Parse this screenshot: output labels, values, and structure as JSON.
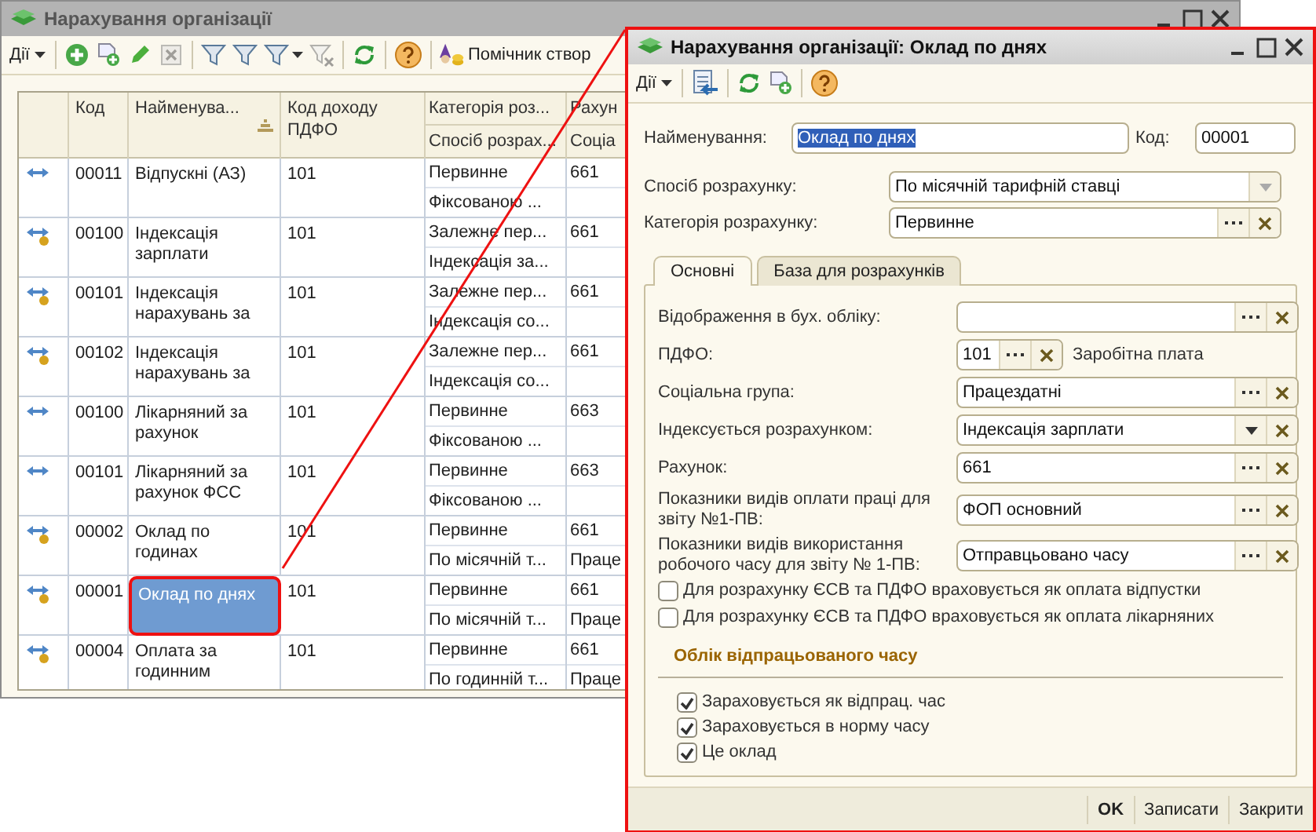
{
  "main_window": {
    "title": "Нарахування організації",
    "toolbar": {
      "actions_menu": "Дії",
      "buttons": [
        {
          "kind": "add",
          "disabled": false
        },
        {
          "kind": "copy",
          "disabled": false
        },
        {
          "kind": "edit",
          "disabled": false
        },
        {
          "kind": "delete",
          "disabled": true
        },
        {
          "kind": "separator"
        },
        {
          "kind": "filter",
          "disabled": false
        },
        {
          "kind": "filter",
          "disabled": false
        },
        {
          "kind": "filter-menu",
          "disabled": false
        },
        {
          "kind": "filter-clear",
          "disabled": true
        },
        {
          "kind": "separator"
        },
        {
          "kind": "refresh",
          "disabled": false
        },
        {
          "kind": "separator"
        },
        {
          "kind": "help",
          "disabled": false
        },
        {
          "kind": "separator"
        }
      ],
      "wizard_button": "Помічник створ"
    },
    "table": {
      "columns": [
        {
          "label": "Код",
          "sorted": false
        },
        {
          "label": "Найменува...",
          "sorted": true
        },
        {
          "label": "Код доходу ПДФО",
          "sorted": false
        },
        {
          "label": "Категорія роз...",
          "sublabel": "Спосіб розрах...",
          "sorted": false
        },
        {
          "label": "Рахун",
          "sublabel": "Соціа",
          "sorted": false
        }
      ],
      "rows": [
        {
          "kind": "plain",
          "code": "00011",
          "name": "Відпускні (АЗ)",
          "pdfo": "101",
          "category": "Первинне",
          "method": "Фіксованою ...",
          "account": "661",
          "selected": false
        },
        {
          "kind": "coin",
          "code": "00100",
          "name": "Індексація зарплати",
          "pdfo": "101",
          "category": "Залежне пер...",
          "method": "Індексація за...",
          "account": "661",
          "selected": false
        },
        {
          "kind": "coin",
          "code": "00101",
          "name": "Індексація нарахувань за",
          "pdfo": "101",
          "category": "Залежне пер...",
          "method": "Індексація со...",
          "account": "661",
          "selected": false
        },
        {
          "kind": "coin",
          "code": "00102",
          "name": "Індексація нарахувань за",
          "pdfo": "101",
          "category": "Залежне пер...",
          "method": "Індексація со...",
          "account": "661",
          "selected": false
        },
        {
          "kind": "plain",
          "code": "00100",
          "name": "Лікарняний за рахунок",
          "pdfo": "101",
          "category": "Первинне",
          "method": "Фіксованою ...",
          "account": "663",
          "selected": false
        },
        {
          "kind": "plain",
          "code": "00101",
          "name": "Лікарняний за рахунок ФСС",
          "pdfo": "101",
          "category": "Первинне",
          "method": "Фіксованою ...",
          "account": "663",
          "selected": false
        },
        {
          "kind": "coin",
          "code": "00002",
          "name": "Оклад по годинах",
          "pdfo": "101",
          "category": "Первинне",
          "method": "По місячній т...",
          "account": "661",
          "group": "Праце",
          "selected": false
        },
        {
          "kind": "coin",
          "code": "00001",
          "name": "Оклад по днях",
          "pdfo": "101",
          "category": "Первинне",
          "method": "По місячній т...",
          "account": "661",
          "group": "Праце",
          "selected": true
        },
        {
          "kind": "coin",
          "code": "00004",
          "name": "Оплата за годинним",
          "pdfo": "101",
          "category": "Первинне",
          "method": "По годинній т...",
          "account": "661",
          "group": "Праце",
          "selected": false
        }
      ]
    }
  },
  "dialog": {
    "title": "Нарахування організації: Оклад по днях",
    "toolbar": {
      "actions_menu": "Дії",
      "buttons": [
        {
          "kind": "write-back"
        },
        {
          "kind": "separator"
        },
        {
          "kind": "refresh"
        },
        {
          "kind": "copy"
        },
        {
          "kind": "separator"
        },
        {
          "kind": "help"
        }
      ]
    },
    "name": {
      "label": "Найменування:",
      "value": "Оклад по днях"
    },
    "code": {
      "label": "Код:",
      "value": "00001"
    },
    "fields": [
      {
        "label": "Спосіб розрахунку:",
        "value": "По місячній тарифній ставці",
        "kind": "dropdown"
      },
      {
        "label": "Категорія розрахунку:",
        "value": "Первинне",
        "kind": "reference"
      }
    ],
    "tabs": [
      {
        "label": "Основні",
        "selected": true
      },
      {
        "label": "База для розрахунків",
        "selected": false
      }
    ],
    "tab_fields": [
      {
        "label": "Відображення в бух. обліку:",
        "kind": "reference"
      },
      {
        "label": "ПДФО:",
        "value": "101",
        "kind": "short",
        "note": "Заробітна плата"
      },
      {
        "label": "Соціальна група:",
        "value": "Працездатні",
        "kind": "reference"
      },
      {
        "label": "Індексується розрахунком:",
        "value": "Індексація зарплати",
        "kind": "list"
      },
      {
        "label": "Рахунок:",
        "value": "661",
        "kind": "reference"
      },
      {
        "label": "Показники видів оплати праці для звіту №1-ПВ:",
        "value": "ФОП основний",
        "kind": "reference"
      },
      {
        "label": "Показники видів використання робочого часу для звіту № 1-ПВ:",
        "value": "Отправцьовано часу",
        "kind": "reference"
      }
    ],
    "checkboxes": [
      {
        "label": "Для розрахунку ЄСВ та ПДФО враховується як оплата відпустки",
        "checked": false
      },
      {
        "label": "Для розрахунку ЄСВ та ПДФО враховується як оплата лікарняних",
        "checked": false
      }
    ],
    "section": {
      "title": "Облік відпрацьованого часу",
      "checkboxes": [
        {
          "label": "Зараховується як відпрац. час",
          "checked": true
        },
        {
          "label": "Зараховується в норму часу",
          "checked": true
        },
        {
          "label": "Це оклад",
          "checked": true
        }
      ]
    },
    "buttons": [
      {
        "label": "OK",
        "default": true
      },
      {
        "label": "Записати",
        "default": false
      },
      {
        "label": "Закрити",
        "default": false
      }
    ]
  }
}
